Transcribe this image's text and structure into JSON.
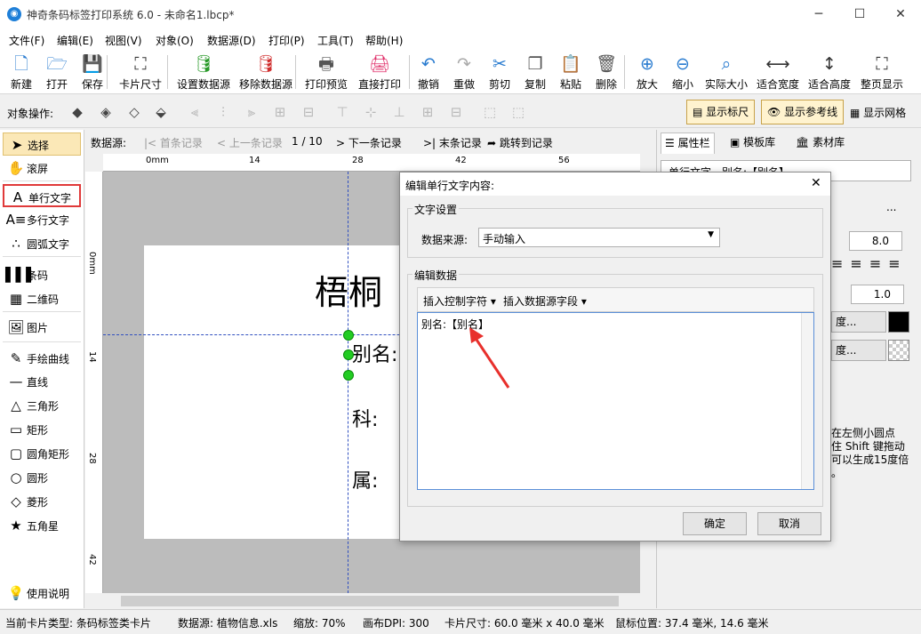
{
  "window": {
    "title": "神奇条码标签打印系统 6.0 - 未命名1.lbcp*",
    "min": "─",
    "max": "☐",
    "close": "✕"
  },
  "menu": [
    "文件(F)",
    "编辑(E)",
    "视图(V)",
    "对象(O)",
    "数据源(D)",
    "打印(P)",
    "工具(T)",
    "帮助(H)"
  ],
  "toolbar": [
    {
      "label": "新建",
      "icon": "new-file-icon",
      "glyph": "🗋"
    },
    {
      "label": "打开",
      "icon": "open-icon",
      "glyph": "🗁"
    },
    {
      "label": "保存",
      "icon": "save-icon",
      "glyph": "💾"
    },
    {
      "label": "卡片尺寸",
      "icon": "card-size-icon",
      "glyph": "⛶"
    },
    {
      "label": "设置数据源",
      "icon": "database-settings-icon",
      "glyph": "🛢"
    },
    {
      "label": "移除数据源",
      "icon": "database-remove-icon",
      "glyph": "🛢"
    },
    {
      "label": "打印预览",
      "icon": "print-preview-icon",
      "glyph": "🖶"
    },
    {
      "label": "直接打印",
      "icon": "print-icon",
      "glyph": "🖨"
    },
    {
      "label": "撤销",
      "icon": "undo-icon",
      "glyph": "↶"
    },
    {
      "label": "重做",
      "icon": "redo-icon",
      "glyph": "↷"
    },
    {
      "label": "剪切",
      "icon": "cut-icon",
      "glyph": "✂"
    },
    {
      "label": "复制",
      "icon": "copy-icon",
      "glyph": "❐"
    },
    {
      "label": "粘贴",
      "icon": "paste-icon",
      "glyph": "📋"
    },
    {
      "label": "删除",
      "icon": "delete-icon",
      "glyph": "🗑"
    },
    {
      "label": "放大",
      "icon": "zoom-in-icon",
      "glyph": "⊕"
    },
    {
      "label": "缩小",
      "icon": "zoom-out-icon",
      "glyph": "⊖"
    },
    {
      "label": "实际大小",
      "icon": "actual-size-icon",
      "glyph": "⌕"
    },
    {
      "label": "适合宽度",
      "icon": "fit-width-icon",
      "glyph": "⟷"
    },
    {
      "label": "适合高度",
      "icon": "fit-height-icon",
      "glyph": "↕"
    },
    {
      "label": "整页显示",
      "icon": "full-page-icon",
      "glyph": "⛶"
    }
  ],
  "objbar": {
    "label": "对象操作:",
    "toggles": [
      "显示标尺",
      "显示参考线",
      "显示网格"
    ]
  },
  "tools": [
    {
      "label": "选择",
      "icon": "arrow-select-icon",
      "glyph": "➤",
      "state": "selected"
    },
    {
      "label": "滚屏",
      "icon": "hand-icon",
      "glyph": "✋",
      "state": ""
    },
    {
      "label": "单行文字",
      "icon": "single-text-icon",
      "glyph": "A",
      "state": "highlight"
    },
    {
      "label": "多行文字",
      "icon": "multi-text-icon",
      "glyph": "A≡",
      "state": ""
    },
    {
      "label": "圆弧文字",
      "icon": "arc-text-icon",
      "glyph": "∴",
      "state": ""
    },
    {
      "label": "条码",
      "icon": "barcode-icon",
      "glyph": "▌▌▌",
      "state": ""
    },
    {
      "label": "二维码",
      "icon": "qrcode-icon",
      "glyph": "▦",
      "state": ""
    },
    {
      "label": "图片",
      "icon": "image-icon",
      "glyph": "🖼",
      "state": ""
    },
    {
      "label": "手绘曲线",
      "icon": "pen-icon",
      "glyph": "✎",
      "state": ""
    },
    {
      "label": "直线",
      "icon": "line-icon",
      "glyph": "—",
      "state": ""
    },
    {
      "label": "三角形",
      "icon": "triangle-icon",
      "glyph": "△",
      "state": ""
    },
    {
      "label": "矩形",
      "icon": "rectangle-icon",
      "glyph": "▭",
      "state": ""
    },
    {
      "label": "圆角矩形",
      "icon": "rounded-rect-icon",
      "glyph": "▢",
      "state": ""
    },
    {
      "label": "圆形",
      "icon": "circle-icon",
      "glyph": "○",
      "state": ""
    },
    {
      "label": "菱形",
      "icon": "diamond-icon",
      "glyph": "◇",
      "state": ""
    },
    {
      "label": "五角星",
      "icon": "star-icon",
      "glyph": "★",
      "state": ""
    }
  ],
  "help": "使用说明",
  "nav": {
    "label": "数据源:",
    "first": "首条记录",
    "prev": "上一条记录",
    "record": "1 / 10",
    "next": "下一条记录",
    "last": "末条记录",
    "jump": "跳转到记录"
  },
  "ruler": {
    "h": [
      "0mm",
      "14",
      "28",
      "42",
      "56"
    ],
    "v": [
      "0mm",
      "14",
      "28",
      "42"
    ]
  },
  "card": {
    "title": "梧桐",
    "line1": "别名:",
    "line2": "科:",
    "line3": "属:"
  },
  "panel": {
    "tabs": [
      "属性栏",
      "模板库",
      "素材库"
    ],
    "object_select": "单行文字 - 别名:【别名】",
    "font_size": "8.0",
    "spacing": "1.0",
    "color_btn": "度...",
    "color_btn2": "度...",
    "hint": "在左侧小圆点\n住 Shift 键拖动\n可以生成15度倍\n。",
    "more": "..."
  },
  "dialog": {
    "title": "编辑单行文字内容:",
    "group1": "文字设置",
    "source_label": "数据来源:",
    "source_value": "手动输入",
    "group2": "编辑数据",
    "insert_ctrl": "插入控制字符",
    "insert_field": "插入数据源字段",
    "content": "别名:【别名】",
    "ok": "确定",
    "cancel": "取消"
  },
  "status": {
    "card_type": "当前卡片类型: 条码标签类卡片",
    "datasource": "数据源: 植物信息.xls",
    "zoom": "缩放: 70%",
    "dpi": "画布DPI: 300",
    "card_size": "卡片尺寸: 60.0 毫米 x 40.0 毫米",
    "mouse": "鼠标位置: 37.4 毫米, 14.6 毫米"
  },
  "colors": {
    "accent": "#1e7fd8",
    "toggle_bg": "#fff3cf",
    "highlight": "#e03a3a",
    "handle": "#22cc22",
    "arrow": "#e8302c"
  }
}
